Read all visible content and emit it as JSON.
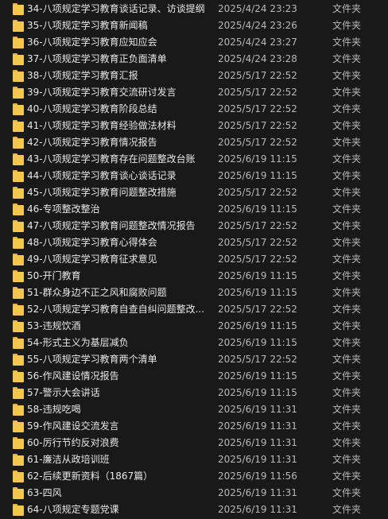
{
  "files": [
    {
      "name": "34-八项规定学习教育谈话记录、访谈提纲",
      "modified": "2025/4/24 23:23",
      "type": "文件夹"
    },
    {
      "name": "35-八项规定学习教育新闻稿",
      "modified": "2025/4/24 23:26",
      "type": "文件夹"
    },
    {
      "name": "36-八项规定学习教育应知应会",
      "modified": "2025/4/24 23:27",
      "type": "文件夹"
    },
    {
      "name": "37-八项规定学习教育正负面清单",
      "modified": "2025/4/24 23:28",
      "type": "文件夹"
    },
    {
      "name": "38-八项规定学习教育汇报",
      "modified": "2025/5/17 22:52",
      "type": "文件夹"
    },
    {
      "name": "39-八项规定学习教育交流研讨发言",
      "modified": "2025/5/17 22:52",
      "type": "文件夹"
    },
    {
      "name": "40-八项规定学习教育阶段总结",
      "modified": "2025/5/17 22:52",
      "type": "文件夹"
    },
    {
      "name": "41-八项规定学习教育经验做法材料",
      "modified": "2025/5/17 22:52",
      "type": "文件夹"
    },
    {
      "name": "42-八项规定学习教育情况报告",
      "modified": "2025/5/17 22:52",
      "type": "文件夹"
    },
    {
      "name": "43-八项规定学习教育存在问题整改台账",
      "modified": "2025/6/19 11:15",
      "type": "文件夹"
    },
    {
      "name": "44-八项规定学习教育谈心谈话记录",
      "modified": "2025/6/19 11:15",
      "type": "文件夹"
    },
    {
      "name": "45-八项规定学习教育问题整改措施",
      "modified": "2025/5/17 22:52",
      "type": "文件夹"
    },
    {
      "name": "46-专项整改整治",
      "modified": "2025/6/19 11:15",
      "type": "文件夹"
    },
    {
      "name": "47-八项规定学习教育问题整改情况报告",
      "modified": "2025/5/17 22:52",
      "type": "文件夹"
    },
    {
      "name": "48-八项规定学习教育心得体会",
      "modified": "2025/5/17 22:52",
      "type": "文件夹"
    },
    {
      "name": "49-八项规定学习教育征求意见",
      "modified": "2025/5/17 22:52",
      "type": "文件夹"
    },
    {
      "name": "50-开门教育",
      "modified": "2025/6/19 11:15",
      "type": "文件夹"
    },
    {
      "name": "51-群众身边不正之风和腐败问题",
      "modified": "2025/6/19 11:15",
      "type": "文件夹"
    },
    {
      "name": "52-八项规定学习教育自查自纠问题整改...",
      "modified": "2025/5/17 22:52",
      "type": "文件夹"
    },
    {
      "name": "53-违规饮酒",
      "modified": "2025/6/19 11:15",
      "type": "文件夹"
    },
    {
      "name": "54-形式主义为基层减负",
      "modified": "2025/6/19 11:15",
      "type": "文件夹"
    },
    {
      "name": "55-八项规定学习教育两个清单",
      "modified": "2025/5/17 22:52",
      "type": "文件夹"
    },
    {
      "name": "56-作风建设情况报告",
      "modified": "2025/6/19 11:15",
      "type": "文件夹"
    },
    {
      "name": "57-警示大会讲话",
      "modified": "2025/6/19 11:15",
      "type": "文件夹"
    },
    {
      "name": "58-违规吃喝",
      "modified": "2025/6/19 11:31",
      "type": "文件夹"
    },
    {
      "name": "59-作风建设交流发言",
      "modified": "2025/6/19 11:31",
      "type": "文件夹"
    },
    {
      "name": "60-厉行节约反对浪费",
      "modified": "2025/6/19 11:31",
      "type": "文件夹"
    },
    {
      "name": "61-廉洁从政培训班",
      "modified": "2025/6/19 11:31",
      "type": "文件夹"
    },
    {
      "name": "62-后续更新资料（1867篇）",
      "modified": "2025/6/19 11:56",
      "type": "文件夹"
    },
    {
      "name": "63-四风",
      "modified": "2025/6/19 11:31",
      "type": "文件夹"
    },
    {
      "name": "64-八项规定专题党课",
      "modified": "2025/6/19 11:31",
      "type": "文件夹"
    }
  ],
  "icons": {
    "folder": "folder-icon"
  },
  "colors": {
    "background": "#191919",
    "folder": "#f3c64f",
    "text": "#e8e8e8",
    "secondary_text": "#b8b8b8"
  }
}
